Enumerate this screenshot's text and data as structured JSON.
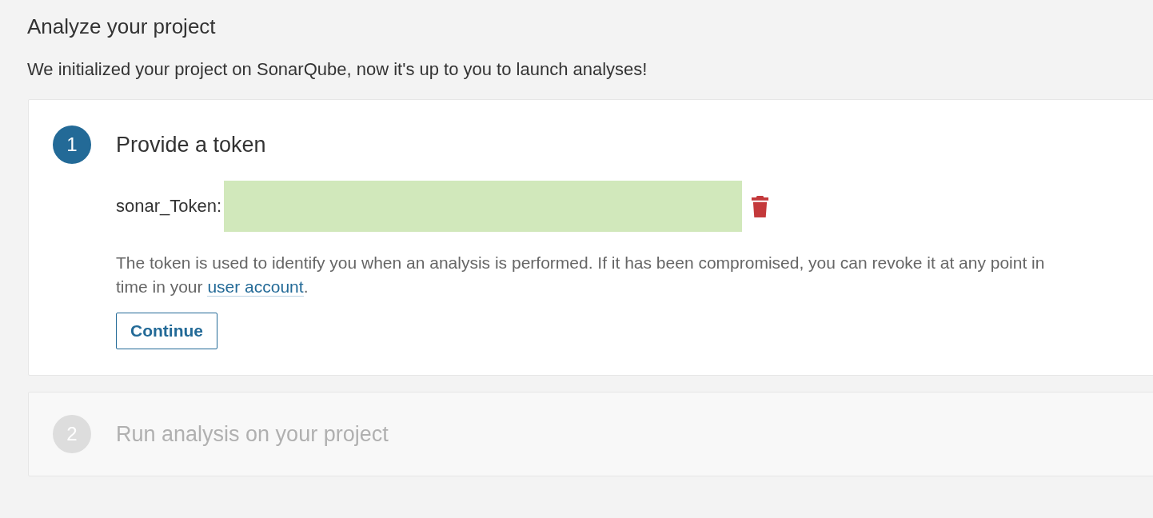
{
  "title": "Analyze your project",
  "subtitle": "We initialized your project on SonarQube, now it's up to you to launch analyses!",
  "steps": [
    {
      "number": "1",
      "title": "Provide a token",
      "active": true,
      "token": {
        "label": "sonar_Token:"
      },
      "help": {
        "text_before": "The token is used to identify you when an analysis is performed. If it has been compromised, you can revoke it at any point in time in your ",
        "link": "user account",
        "text_after": "."
      },
      "button": "Continue"
    },
    {
      "number": "2",
      "title": "Run analysis on your project",
      "active": false
    }
  ]
}
